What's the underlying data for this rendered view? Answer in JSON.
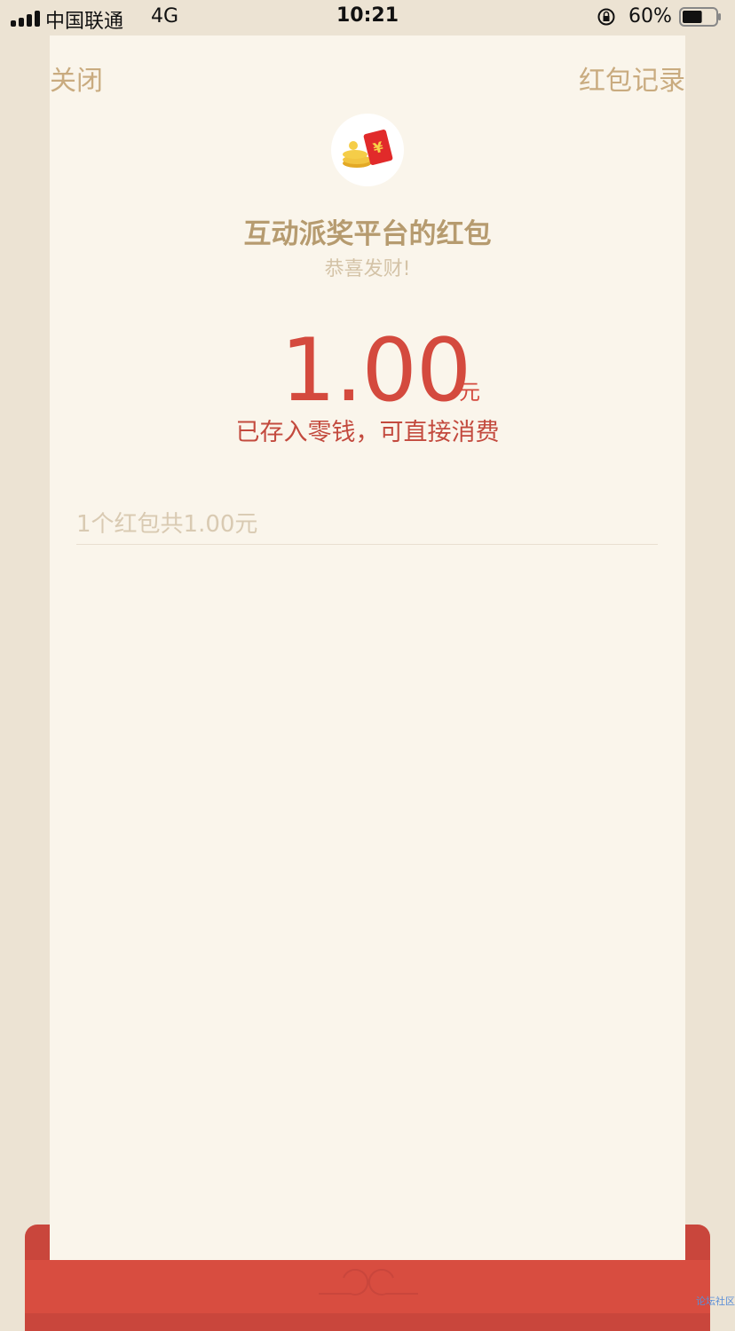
{
  "status_bar": {
    "carrier": "中国联通",
    "network": "4G",
    "time": "10:21",
    "battery": "60%",
    "battery_level": 0.6
  },
  "header": {
    "close_label": "关闭",
    "records_label": "红包记录"
  },
  "packet": {
    "sender": "互动派奖平台的红包",
    "greeting": "恭喜发财!",
    "amount": "1.00",
    "unit": "元",
    "note": "已存入零钱，可直接消费",
    "summary": "1个红包共1.00元"
  },
  "icons": {
    "avatar": "red-envelope-coins-icon",
    "lock": "rotation-lock-icon",
    "battery": "battery-icon"
  },
  "colors": {
    "amount": "#d44a3e",
    "sender": "#b69b6f",
    "background": "#faf5eb",
    "packet_red": "#d84d40"
  },
  "watermark": "论坛社区"
}
